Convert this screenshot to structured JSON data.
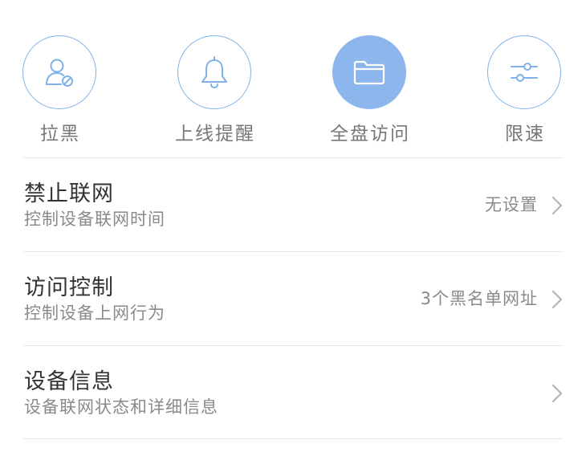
{
  "colors": {
    "accent_blue": "#7fb1e8",
    "active_fill": "#8db7ec",
    "title_text": "#333333",
    "secondary_text": "#8a8a8a",
    "divider": "#e5e5e5"
  },
  "actions": [
    {
      "label": "拉黑",
      "icon": "user-block-icon",
      "active": false
    },
    {
      "label": "上线提醒",
      "icon": "bell-icon",
      "active": false
    },
    {
      "label": "全盘访问",
      "icon": "folder-icon",
      "active": true
    },
    {
      "label": "限速",
      "icon": "sliders-icon",
      "active": false
    }
  ],
  "rows": [
    {
      "title": "禁止联网",
      "subtitle": "控制设备联网时间",
      "value": "无设置"
    },
    {
      "title": "访问控制",
      "subtitle": "控制设备上网行为",
      "value": "3个黑名单网址"
    },
    {
      "title": "设备信息",
      "subtitle": "设备联网状态和详细信息",
      "value": ""
    }
  ]
}
